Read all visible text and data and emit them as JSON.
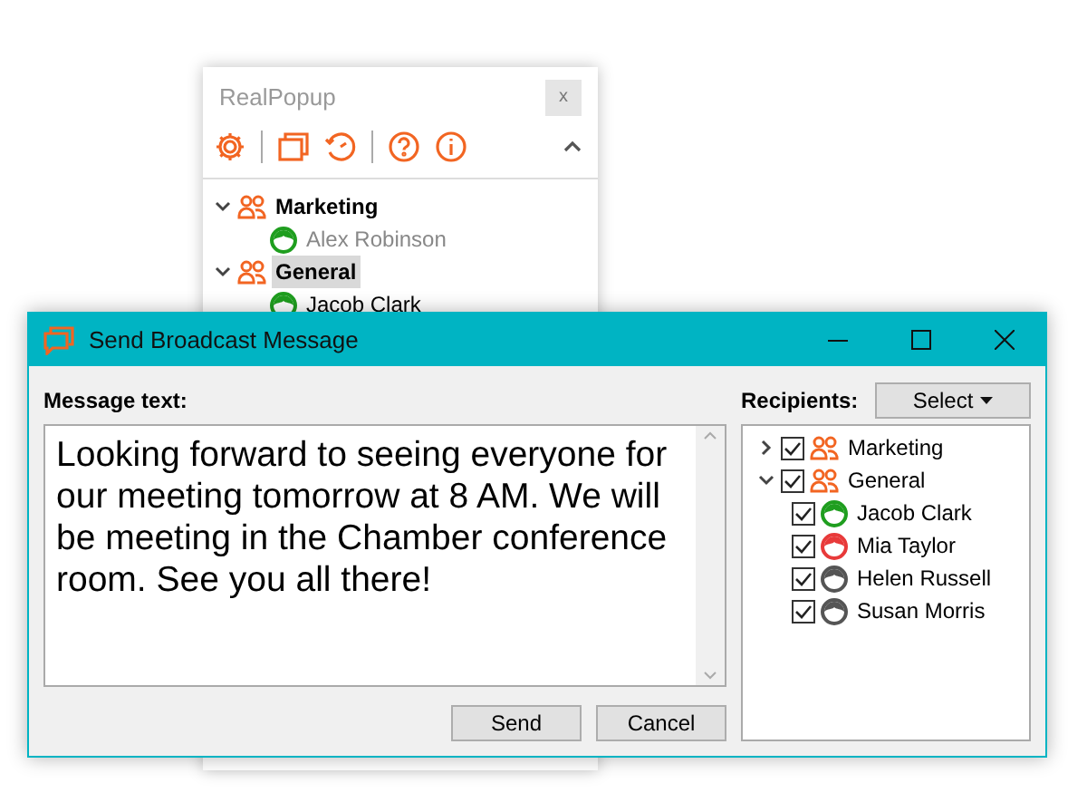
{
  "popup": {
    "title": "RealPopup",
    "close_label": "x",
    "tree": [
      {
        "kind": "group",
        "label": "Marketing",
        "expanded": true,
        "selected": false,
        "children": [
          {
            "kind": "person",
            "label": "Alex Robinson",
            "color": "#1f9e1f",
            "dimmed": true,
            "selected": false
          }
        ]
      },
      {
        "kind": "group",
        "label": "General",
        "expanded": true,
        "selected": true,
        "children": [
          {
            "kind": "person",
            "label": "Jacob Clark",
            "color": "#1f9e1f",
            "dimmed": false,
            "selected": false
          }
        ]
      }
    ]
  },
  "dialog": {
    "title": "Send Broadcast Message",
    "message_label": "Message text:",
    "message": "Looking forward to seeing everyone for our meeting tomorrow at 8 AM. We will be meeting in the Chamber conference room. See you all there!",
    "recipients_label": "Recipients:",
    "select_button": "Select",
    "recipients": [
      {
        "kind": "group",
        "label": "Marketing",
        "checked": true,
        "expanded": false
      },
      {
        "kind": "group",
        "label": "General",
        "checked": true,
        "expanded": true,
        "children": [
          {
            "kind": "person",
            "label": "Jacob Clark",
            "checked": true,
            "color": "#1f9e1f"
          },
          {
            "kind": "person",
            "label": "Mia Taylor",
            "checked": true,
            "color": "#e83a3a"
          },
          {
            "kind": "person",
            "label": "Helen Russell",
            "checked": true,
            "color": "#555555"
          },
          {
            "kind": "person",
            "label": "Susan Morris",
            "checked": true,
            "color": "#555555"
          }
        ]
      }
    ],
    "buttons": [
      "Send",
      "Cancel"
    ]
  }
}
